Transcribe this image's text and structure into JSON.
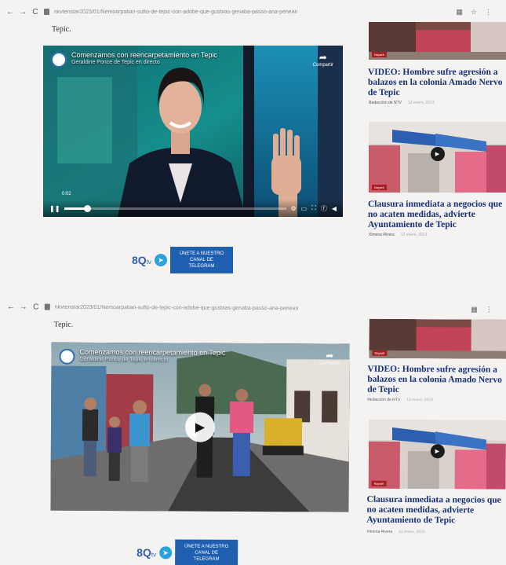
{
  "browser": {
    "back": "←",
    "forward": "→",
    "reload": "C",
    "url": "nkvtenstar2023/01/Nemoarpatian-sufto-de-tepic-con-adobe-que-gusbias-genaba-passo-ana-penean",
    "icons": [
      "grid-icon",
      "star-icon",
      "menu-icon"
    ]
  },
  "screens": [
    {
      "tepic_text": "Tepic.",
      "video": {
        "title": "Comenzamos con reencarpetamiento en Tepic",
        "subtitle": "Geraldine Ponce de Tepic en directo",
        "share_label": "Compartir",
        "timecode": "0:02",
        "progress": 0.1,
        "playing": true
      },
      "cta": {
        "logo": "8Q",
        "logo_suffix": "tv",
        "button": "ÚNETE A NUESTRO CANAL DE TELEGRAM"
      },
      "side": [
        {
          "tag": "Nayarit",
          "headline": "VIDEO: Hombre sufre agresión a balazos en la colonia Amado Nervo de Tepic",
          "author": "Redacción de NTV",
          "date": "12 enero, 2023",
          "has_play": false
        },
        {
          "tag": "Nayarit",
          "headline": "Clausura inmediata a negocios que no acaten medidas, advierte Ayuntamiento de Tepic",
          "author": "Ximena Rivera",
          "date": "12 enero, 2023",
          "has_play": true
        }
      ]
    },
    {
      "tepic_text": "Tepic.",
      "video": {
        "title": "Comenzamos con reencarpetamiento en Tepic",
        "subtitle": "Geraldine Ponce de Tepic en directo",
        "share_label": "Compartir",
        "timecode": "",
        "progress": 0,
        "playing": false
      },
      "cta": {
        "logo": "8Q",
        "logo_suffix": "tv",
        "button": "ÚNETE A NUESTRO CANAL DE TELEGRAM"
      },
      "side": [
        {
          "tag": "Nayarit",
          "headline": "VIDEO: Hombre sufre agresión a balazos en la colonia Amado Nervo de Tepic",
          "author": "Redacción de NTV",
          "date": "12 enero, 2023",
          "has_play": false
        },
        {
          "tag": "Nayarit",
          "headline": "Clausura inmediata a negocios que no acaten medidas, advierte Ayuntamiento de Tepic",
          "author": "Ximena Rivera",
          "date": "12 enero, 2023",
          "has_play": true
        }
      ]
    }
  ],
  "colors": {
    "headline": "#17307a",
    "telegram_button": "#1f5fb0",
    "telegram_icon": "#2aa2dc",
    "brand_logo": "#2f5fae",
    "tag_red": "#a51e22"
  }
}
